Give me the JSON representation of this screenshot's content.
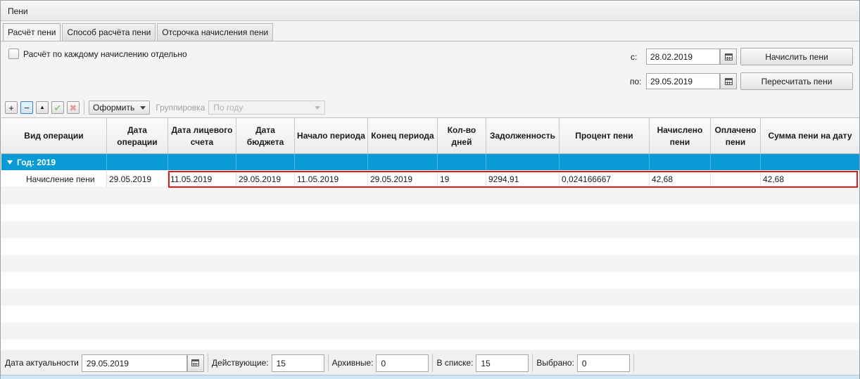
{
  "window": {
    "title": "Пени"
  },
  "tabs": [
    {
      "label": "Расчёт пени",
      "active": true
    },
    {
      "label": "Способ расчёта пени",
      "active": false
    },
    {
      "label": "Отсрочка начисления пени",
      "active": false
    }
  ],
  "options": {
    "per_accrual_label": "Расчёт по каждому начислению отдельно",
    "per_accrual_checked": false
  },
  "period": {
    "from_label": "с:",
    "from_value": "28.02.2019",
    "to_label": "по:",
    "to_value": "29.05.2019"
  },
  "actions": {
    "calc_label": "Начислить пени",
    "recalc_label": "Пересчитать пени"
  },
  "toolbar": {
    "add_glyph": "+",
    "remove_glyph": "−",
    "up_glyph": "▲",
    "ok_glyph": "✔",
    "delete_glyph": "✖",
    "format_label": "Оформить",
    "grouping_label": "Группировка",
    "grouping_value": "По году"
  },
  "grid": {
    "columns": [
      "Вид операции",
      "Дата операции",
      "Дата лицевого счета",
      "Дата бюджета",
      "Начало периода",
      "Конец периода",
      "Кол-во дней",
      "Задолженность",
      "Процент пени",
      "Начислено пени",
      "Оплачено пени",
      "Сумма пени на дату"
    ],
    "group_label": "Год: 2019",
    "rows": [
      [
        "Начисление пени",
        "29.05.2019",
        "11.05.2019",
        "29.05.2019",
        "11.05.2019",
        "29.05.2019",
        "19",
        "9294,91",
        "0,024166667",
        "42,68",
        "",
        "42,68"
      ]
    ],
    "selection_color": "#0a9bd6",
    "highlight_color": "#e01b1b"
  },
  "status": {
    "actual_date_label": "Дата актуальности",
    "actual_date_value": "29.05.2019",
    "active_label": "Действующие:",
    "active_value": "15",
    "archive_label": "Архивные:",
    "archive_value": "0",
    "in_list_label": "В списке:",
    "in_list_value": "15",
    "selected_label": "Выбрано:",
    "selected_value": "0"
  }
}
